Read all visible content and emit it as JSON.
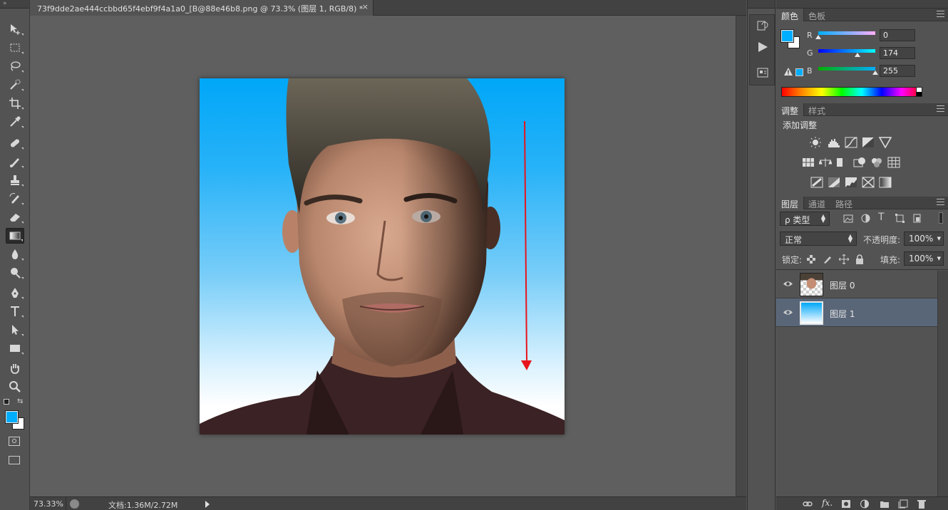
{
  "document": {
    "tab_title": "73f9dde2ae444ccbbd65f4ebf9f4a1a0_[B@88e46b8.png @ 73.3% (图层 1, RGB/8) *",
    "close_glyph": "×",
    "gradient_top": "#00a7f8",
    "gradient_bottom": "#ffffff"
  },
  "statusbar": {
    "zoom": "73.33%",
    "doc_info": "文档:1.36M/2.72M"
  },
  "toolbar": {
    "foreground_color": "#00aeff",
    "background_color": "#ffffff",
    "tools": [
      "move-tool",
      "marquee-tool",
      "lasso-tool",
      "quick-select-tool",
      "crop-tool",
      "eyedropper-tool",
      "healing-brush-tool",
      "brush-tool",
      "clone-stamp-tool",
      "history-brush-tool",
      "eraser-tool",
      "gradient-tool",
      "blur-tool",
      "dodge-tool",
      "pen-tool",
      "type-tool",
      "path-select-tool",
      "rectangle-tool",
      "hand-tool",
      "zoom-tool"
    ]
  },
  "color_panel": {
    "tabs": [
      "颜色",
      "色板"
    ],
    "channels": [
      {
        "label": "R",
        "value": "0",
        "level": 0
      },
      {
        "label": "G",
        "value": "174",
        "level": 0.682
      },
      {
        "label": "B",
        "value": "255",
        "level": 1.0
      }
    ],
    "current_color": "#00aeff"
  },
  "adjustments_panel": {
    "tabs": [
      "调整",
      "样式"
    ],
    "heading": "添加调整"
  },
  "layers_panel": {
    "tabs": [
      "图层",
      "通道",
      "路径"
    ],
    "filter_kind": "ρ 类型",
    "blend_mode": "正常",
    "opacity_label": "不透明度:",
    "opacity_value": "100%",
    "lock_label": "锁定:",
    "fill_label": "填充:",
    "fill_value": "100%",
    "layers": [
      {
        "name": "图层 0",
        "selected": false
      },
      {
        "name": "图层 1",
        "selected": true
      }
    ]
  }
}
